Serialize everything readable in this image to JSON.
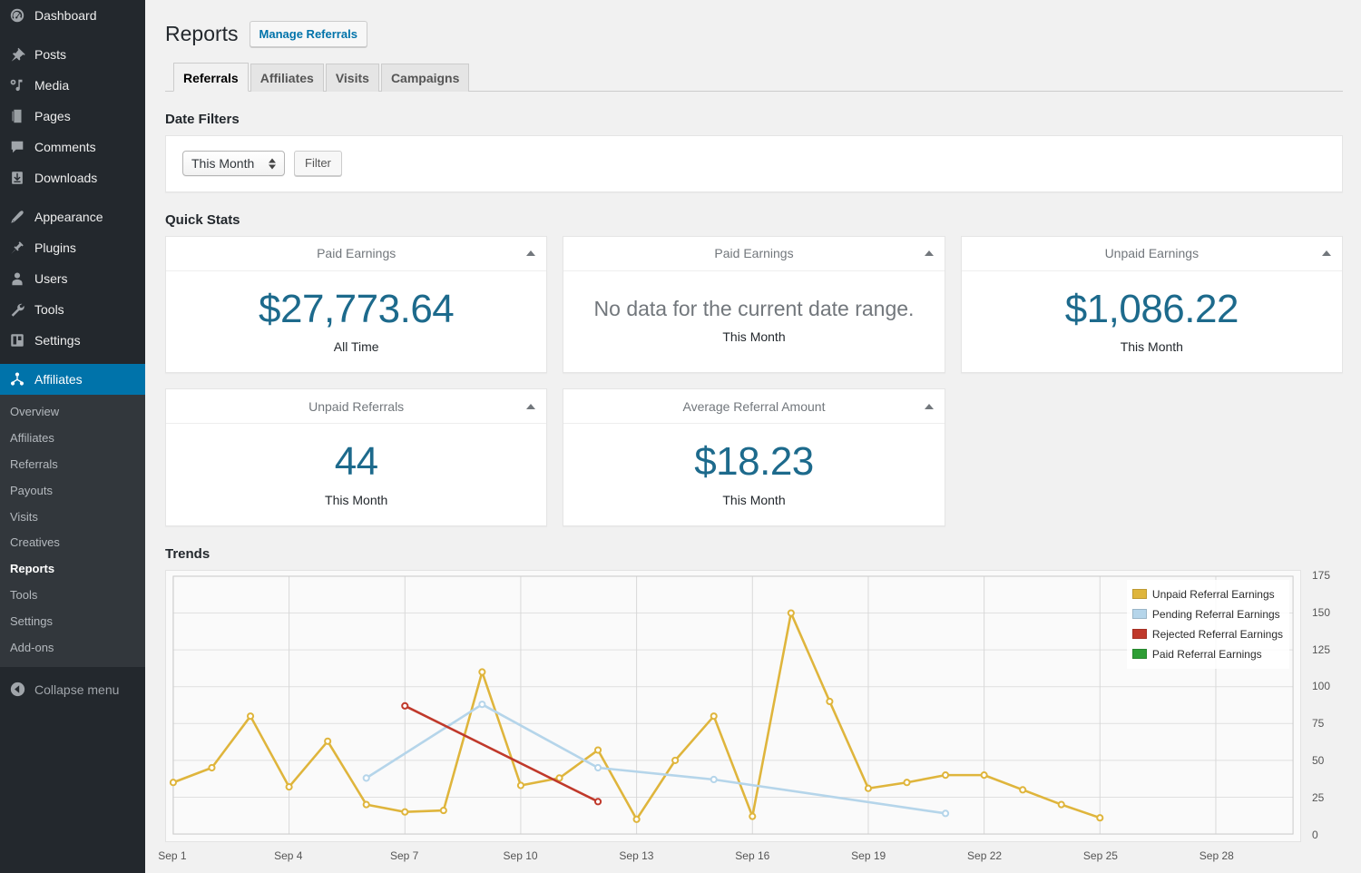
{
  "sidebar": {
    "primary": [
      {
        "label": "Dashboard",
        "icon": "dashboard-icon"
      },
      {
        "label": "Posts",
        "icon": "pin-icon"
      },
      {
        "label": "Media",
        "icon": "media-icon"
      },
      {
        "label": "Pages",
        "icon": "pages-icon"
      },
      {
        "label": "Comments",
        "icon": "comment-icon"
      },
      {
        "label": "Downloads",
        "icon": "download-icon"
      },
      {
        "label": "Appearance",
        "icon": "appearance-icon"
      },
      {
        "label": "Plugins",
        "icon": "plugin-icon"
      },
      {
        "label": "Users",
        "icon": "user-icon"
      },
      {
        "label": "Tools",
        "icon": "wrench-icon"
      },
      {
        "label": "Settings",
        "icon": "settings-icon"
      }
    ],
    "current": {
      "label": "Affiliates",
      "icon": "affiliates-network-icon"
    },
    "submenu": [
      {
        "label": "Overview",
        "active": false
      },
      {
        "label": "Affiliates",
        "active": false
      },
      {
        "label": "Referrals",
        "active": false
      },
      {
        "label": "Payouts",
        "active": false
      },
      {
        "label": "Visits",
        "active": false
      },
      {
        "label": "Creatives",
        "active": false
      },
      {
        "label": "Reports",
        "active": true
      },
      {
        "label": "Tools",
        "active": false
      },
      {
        "label": "Settings",
        "active": false
      },
      {
        "label": "Add-ons",
        "active": false
      }
    ],
    "collapse_label": "Collapse menu",
    "active_color": "#0073aa"
  },
  "header": {
    "title": "Reports",
    "action_label": "Manage Referrals"
  },
  "tabs": [
    {
      "label": "Referrals",
      "active": true
    },
    {
      "label": "Affiliates",
      "active": false
    },
    {
      "label": "Visits",
      "active": false
    },
    {
      "label": "Campaigns",
      "active": false
    }
  ],
  "date_filters": {
    "section_title": "Date Filters",
    "select_value": "This Month",
    "select_options": [
      "This Month"
    ],
    "filter_button": "Filter"
  },
  "quick_stats": {
    "section_title": "Quick Stats",
    "cards": [
      {
        "title": "Paid Earnings",
        "value": "$27,773.64",
        "subtitle": "All Time",
        "nodata": false
      },
      {
        "title": "Paid Earnings",
        "value": "No data for the current date range.",
        "subtitle": "This Month",
        "nodata": true
      },
      {
        "title": "Unpaid Earnings",
        "value": "$1,086.22",
        "subtitle": "This Month",
        "nodata": false
      },
      {
        "title": "Unpaid Referrals",
        "value": "44",
        "subtitle": "This Month",
        "nodata": false
      },
      {
        "title": "Average Referral Amount",
        "value": "$18.23",
        "subtitle": "This Month",
        "nodata": false
      }
    ]
  },
  "trends": {
    "section_title": "Trends"
  },
  "chart_data": {
    "type": "line",
    "title": "Trends",
    "xlabel": "",
    "ylabel": "",
    "ylim": [
      0,
      175
    ],
    "yticks": [
      0,
      25,
      50,
      75,
      100,
      125,
      150,
      175
    ],
    "xticks": [
      "Sep 1",
      "Sep 4",
      "Sep 7",
      "Sep 10",
      "Sep 13",
      "Sep 16",
      "Sep 19",
      "Sep 22",
      "Sep 25",
      "Sep 28"
    ],
    "x_domain": [
      1,
      30
    ],
    "grid": true,
    "legend_position": "top-right",
    "colors": {
      "unpaid": "#dfb53c",
      "pending": "#b5d5ea",
      "rejected": "#c0392b",
      "paid": "#2e9e35"
    },
    "series": [
      {
        "name": "Unpaid Referral Earnings",
        "color": "#dfb53c",
        "points": [
          {
            "x": 1,
            "label": "Sep 1",
            "y": 35
          },
          {
            "x": 2,
            "label": "Sep 2",
            "y": 45
          },
          {
            "x": 3,
            "label": "Sep 3",
            "y": 80
          },
          {
            "x": 4,
            "label": "Sep 4",
            "y": 32
          },
          {
            "x": 5,
            "label": "Sep 5",
            "y": 63
          },
          {
            "x": 6,
            "label": "Sep 6",
            "y": 20
          },
          {
            "x": 7,
            "label": "Sep 7",
            "y": 15
          },
          {
            "x": 8,
            "label": "Sep 8",
            "y": 16
          },
          {
            "x": 9,
            "label": "Sep 9",
            "y": 110
          },
          {
            "x": 10,
            "label": "Sep 10",
            "y": 33
          },
          {
            "x": 11,
            "label": "Sep 11",
            "y": 38
          },
          {
            "x": 12,
            "label": "Sep 12",
            "y": 57
          },
          {
            "x": 13,
            "label": "Sep 13",
            "y": 10
          },
          {
            "x": 14,
            "label": "Sep 14",
            "y": 50
          },
          {
            "x": 15,
            "label": "Sep 15",
            "y": 80
          },
          {
            "x": 16,
            "label": "Sep 16",
            "y": 12
          },
          {
            "x": 17,
            "label": "Sep 17",
            "y": 150
          },
          {
            "x": 18,
            "label": "Sep 18",
            "y": 90
          },
          {
            "x": 19,
            "label": "Sep 19",
            "y": 31
          },
          {
            "x": 20,
            "label": "Sep 20",
            "y": 35
          },
          {
            "x": 21,
            "label": "Sep 21",
            "y": 40
          },
          {
            "x": 22,
            "label": "Sep 22",
            "y": 40
          },
          {
            "x": 23,
            "label": "Sep 23",
            "y": 30
          },
          {
            "x": 24,
            "label": "Sep 24",
            "y": 20
          },
          {
            "x": 25,
            "label": "Sep 25",
            "y": 11
          }
        ]
      },
      {
        "name": "Pending Referral Earnings",
        "color": "#b5d5ea",
        "points": [
          {
            "x": 6,
            "label": "Sep 6",
            "y": 38
          },
          {
            "x": 9,
            "label": "Sep 9",
            "y": 88
          },
          {
            "x": 12,
            "label": "Sep 12",
            "y": 45
          },
          {
            "x": 15,
            "label": "Sep 15",
            "y": 37
          },
          {
            "x": 21,
            "label": "Sep 21",
            "y": 14
          }
        ]
      },
      {
        "name": "Rejected Referral Earnings",
        "color": "#c0392b",
        "points": [
          {
            "x": 7,
            "label": "Sep 7",
            "y": 87
          },
          {
            "x": 12,
            "label": "Sep 12",
            "y": 22
          }
        ]
      },
      {
        "name": "Paid Referral Earnings",
        "color": "#2e9e35",
        "points": []
      }
    ],
    "legend": [
      {
        "label": "Unpaid Referral Earnings",
        "color": "#dfb53c"
      },
      {
        "label": "Pending Referral Earnings",
        "color": "#b5d5ea"
      },
      {
        "label": "Rejected Referral Earnings",
        "color": "#c0392b"
      },
      {
        "label": "Paid Referral Earnings",
        "color": "#2e9e35"
      }
    ]
  }
}
